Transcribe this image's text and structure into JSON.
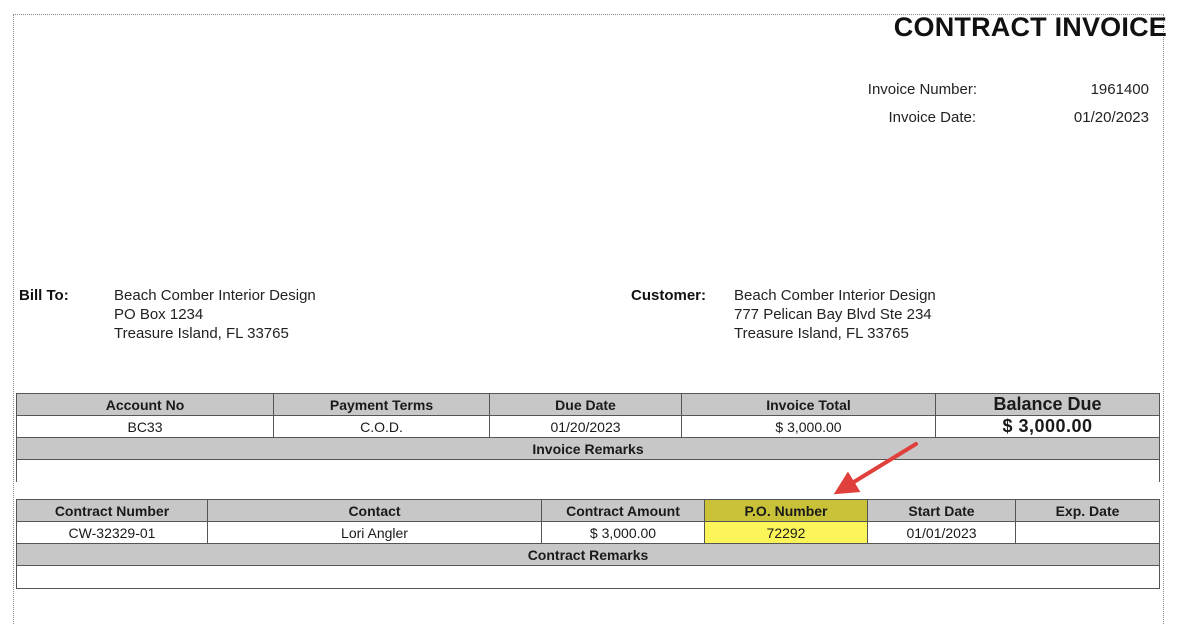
{
  "invoice": {
    "title": "CONTRACT INVOICE",
    "number_label": "Invoice Number:",
    "number": "1961400",
    "date_label": "Invoice Date:",
    "date": "01/20/2023"
  },
  "bill_to": {
    "label": "Bill To:",
    "lines": [
      "Beach Comber Interior Design",
      "PO Box 1234",
      "Treasure Island, FL 33765"
    ]
  },
  "customer": {
    "label": "Customer:",
    "lines": [
      "Beach Comber Interior Design",
      "777 Pelican Bay Blvd Ste 234",
      "Treasure Island, FL  33765"
    ]
  },
  "summary": {
    "headers": [
      "Account No",
      "Payment Terms",
      "Due Date",
      "Invoice Total",
      "Balance Due"
    ],
    "values": [
      "BC33",
      "C.O.D.",
      "01/20/2023",
      "$ 3,000.00",
      "$ 3,000.00"
    ]
  },
  "invoice_remarks": {
    "label": "Invoice Remarks",
    "text": ""
  },
  "contract": {
    "headers": [
      "Contract Number",
      "Contact",
      "Contract Amount",
      "P.O. Number",
      "Start Date",
      "Exp. Date"
    ],
    "values": [
      "CW-32329-01",
      "Lori Angler",
      "$ 3,000.00",
      "72292",
      "01/01/2023",
      ""
    ]
  },
  "contract_remarks": {
    "label": "Contract Remarks",
    "text": ""
  },
  "colors": {
    "header_gray": "#c7c7c7",
    "highlight_header": "#c9c238",
    "highlight_value": "#fbf55a",
    "annotation_arrow": "#e0403c"
  }
}
